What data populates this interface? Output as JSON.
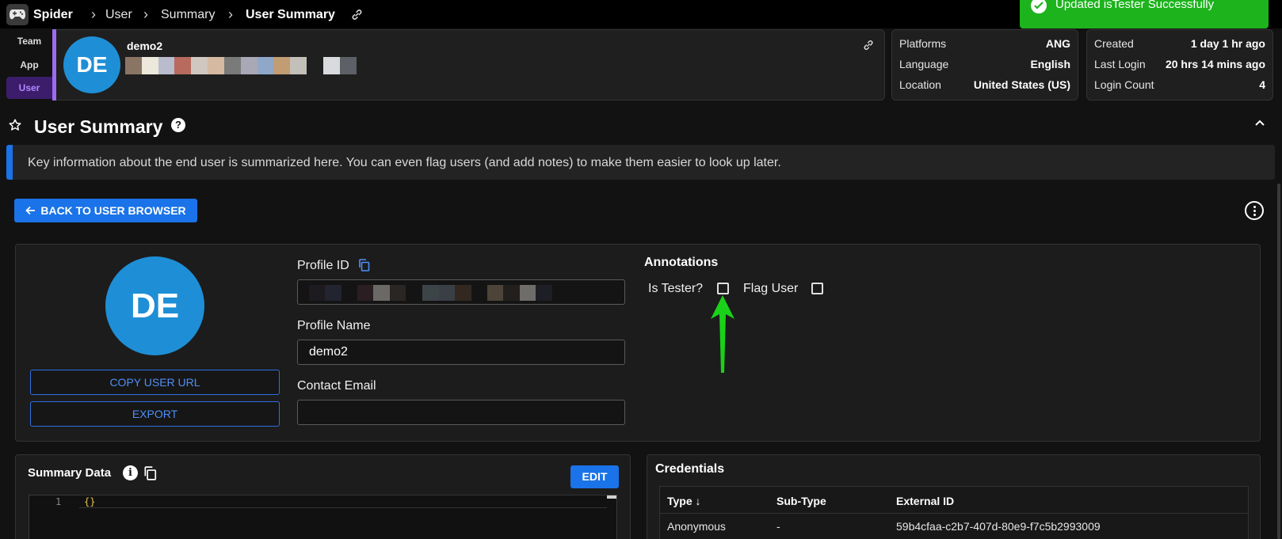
{
  "app": {
    "name": "Spider"
  },
  "breadcrumb": [
    {
      "label": "User"
    },
    {
      "label": "Summary"
    },
    {
      "label": "User Summary"
    }
  ],
  "toast": {
    "message": "Updated isTester Successfully"
  },
  "side_tabs": [
    {
      "label": "Team"
    },
    {
      "label": "App"
    },
    {
      "label": "User"
    }
  ],
  "header": {
    "initials": "DE",
    "name": "demo2"
  },
  "stats_left": [
    {
      "key": "Platforms",
      "value": "ANG"
    },
    {
      "key": "Language",
      "value": "English"
    },
    {
      "key": "Location",
      "value": "United States (US)"
    }
  ],
  "stats_right": [
    {
      "key": "Created",
      "value": "1 day 1 hr ago"
    },
    {
      "key": "Last Login",
      "value": "20 hrs 14 mins ago"
    },
    {
      "key": "Login Count",
      "value": "4"
    }
  ],
  "page": {
    "title": "User Summary",
    "info": "Key information about the end user is summarized here. You can even flag users (and add notes) to make them easier to look up later.",
    "back_button": "BACK TO USER BROWSER"
  },
  "profile": {
    "initials": "DE",
    "copy_url_button": "COPY USER URL",
    "export_button": "EXPORT",
    "profile_id_label": "Profile ID",
    "profile_name_label": "Profile Name",
    "profile_name_value": "demo2",
    "contact_email_label": "Contact Email",
    "contact_email_value": ""
  },
  "annotations": {
    "title": "Annotations",
    "is_tester_label": "Is Tester?",
    "flag_user_label": "Flag User"
  },
  "summary_data": {
    "title": "Summary Data",
    "edit_button": "EDIT",
    "line_number": "1",
    "code": "{}"
  },
  "credentials": {
    "title": "Credentials",
    "columns": [
      "Type ↓",
      "Sub-Type",
      "External ID"
    ],
    "rows": [
      {
        "type": "Anonymous",
        "sub_type": "-",
        "external_id": "59b4cfaa-c2b7-407d-80e9-f7c5b2993009"
      }
    ]
  },
  "colors": {
    "accent": "#1a73e8",
    "avatar": "#1e8fd6",
    "toast": "#1db31d",
    "user_tab": "#3b1d6b"
  }
}
